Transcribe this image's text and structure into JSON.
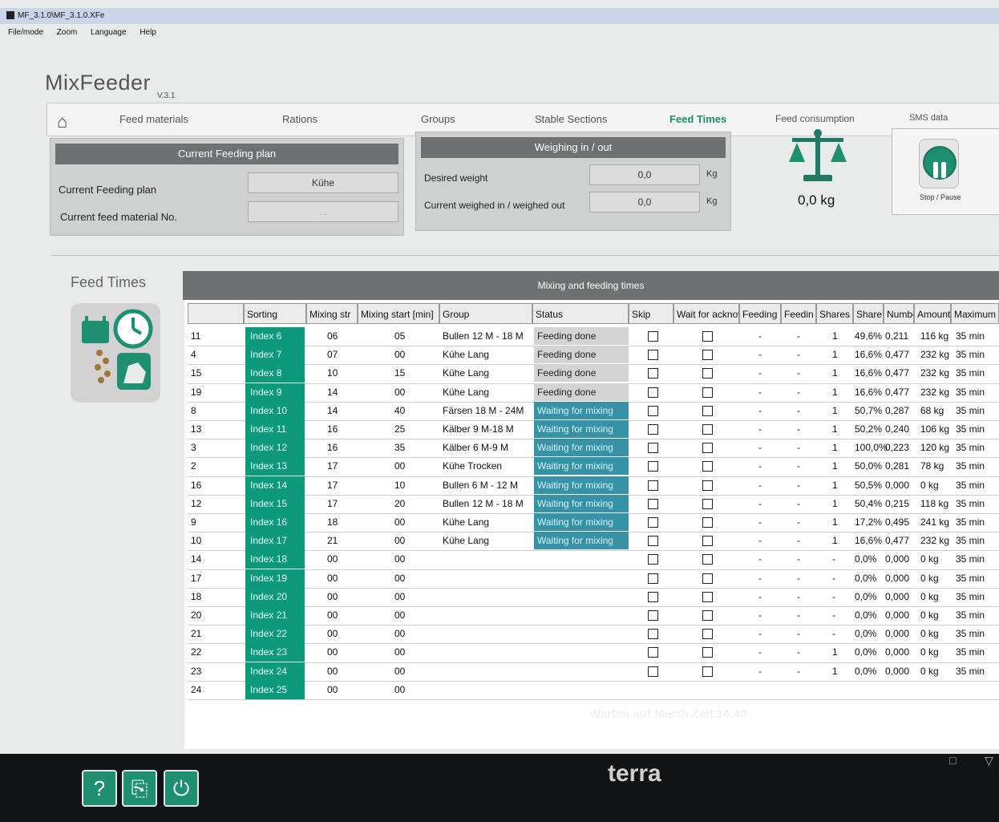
{
  "window": {
    "title": "MF_3.1.0\\MF_3.1.0.XFe"
  },
  "menu": [
    "File/mode",
    "Zoom",
    "Language",
    "Help"
  ],
  "app": {
    "name": "MixFeeder",
    "version": "V.3.1"
  },
  "nav": {
    "tabs": [
      "Feed materials",
      "Rations",
      "Groups",
      "Stable Sections",
      "Feed Times",
      "Feed consumption",
      "SMS data"
    ],
    "active": "Feed Times"
  },
  "current_plan": {
    "header": "Current Feeding plan",
    "plan_label": "Current Feeding plan",
    "plan_value": "Kühe",
    "material_label": "Current feed material No.",
    "material_value": "..."
  },
  "weighing": {
    "header": "Weighing in / out",
    "desired_label": "Desired weight",
    "desired_value": "0,0",
    "desired_unit": "Kg",
    "current_label": "Current weighed in / weighed out",
    "current_value": "0,0",
    "current_unit": "Kg"
  },
  "scale": {
    "value": "0,0 kg"
  },
  "stop": {
    "label": "Stop / Pause"
  },
  "feed_times": {
    "title": "Feed Times"
  },
  "table": {
    "header": "Mixing and feeding times",
    "columns": [
      "",
      "Sorting",
      "Mixing str",
      "Mixing start [min]",
      "Group",
      "Status",
      "Skip",
      "Wait for acknow",
      "Feeding",
      "Feedin",
      "Shares",
      "Share",
      "Numbe",
      "Amount",
      "Maximum"
    ],
    "rows": [
      {
        "id": "11",
        "sort": "Index 6",
        "mix": "06",
        "start": "05",
        "group": "Bullen 12 M - 18 M",
        "status": "Feeding done",
        "feed": "-",
        "feedin": "-",
        "shares": "1",
        "share": "49,6%",
        "num": "0,211",
        "amount": "116 kg",
        "max": "35 min"
      },
      {
        "id": "4",
        "sort": "Index 7",
        "mix": "07",
        "start": "00",
        "group": "Kühe Lang",
        "status": "Feeding done",
        "feed": "-",
        "feedin": "-",
        "shares": "1",
        "share": "16,6%",
        "num": "0,477",
        "amount": "232 kg",
        "max": "35 min"
      },
      {
        "id": "15",
        "sort": "Index 8",
        "mix": "10",
        "start": "15",
        "group": "Kühe Lang",
        "status": "Feeding done",
        "feed": "-",
        "feedin": "-",
        "shares": "1",
        "share": "16,6%",
        "num": "0,477",
        "amount": "232 kg",
        "max": "35 min"
      },
      {
        "id": "19",
        "sort": "Index 9",
        "mix": "14",
        "start": "00",
        "group": "Kühe Lang",
        "status": "Feeding done",
        "feed": "-",
        "feedin": "-",
        "shares": "1",
        "share": "16,6%",
        "num": "0,477",
        "amount": "232 kg",
        "max": "35 min"
      },
      {
        "id": "8",
        "sort": "Index 10",
        "mix": "14",
        "start": "40",
        "group": "Färsen 18 M - 24M",
        "status": "Waiting for mixing",
        "feed": "-",
        "feedin": "-",
        "shares": "1",
        "share": "50,7%",
        "num": "0,287",
        "amount": "68 kg",
        "max": "35 min"
      },
      {
        "id": "13",
        "sort": "Index 11",
        "mix": "16",
        "start": "25",
        "group": "Kälber 9 M-18 M",
        "status": "Waiting for mixing",
        "feed": "-",
        "feedin": "-",
        "shares": "1",
        "share": "50,2%",
        "num": "0,240",
        "amount": "106 kg",
        "max": "35 min"
      },
      {
        "id": "3",
        "sort": "Index 12",
        "mix": "16",
        "start": "35",
        "group": "Kälber 6 M-9 M",
        "status": "Waiting for mixing",
        "feed": "-",
        "feedin": "-",
        "shares": "1",
        "share": "100,0%",
        "num": "0,223",
        "amount": "120 kg",
        "max": "35 min"
      },
      {
        "id": "2",
        "sort": "Index 13",
        "mix": "17",
        "start": "00",
        "group": "Kühe Trocken",
        "status": "Waiting for mixing",
        "feed": "-",
        "feedin": "-",
        "shares": "1",
        "share": "50,0%",
        "num": "0,281",
        "amount": "78 kg",
        "max": "35 min"
      },
      {
        "id": "16",
        "sort": "Index 14",
        "mix": "17",
        "start": "10",
        "group": "Bullen 6 M - 12 M",
        "status": "Waiting for mixing",
        "feed": "-",
        "feedin": "-",
        "shares": "1",
        "share": "50,5%",
        "num": "0,000",
        "amount": "0 kg",
        "max": "35 min"
      },
      {
        "id": "12",
        "sort": "Index 15",
        "mix": "17",
        "start": "20",
        "group": "Bullen 12 M - 18 M",
        "status": "Waiting for mixing",
        "feed": "-",
        "feedin": "-",
        "shares": "1",
        "share": "50,4%",
        "num": "0,215",
        "amount": "118 kg",
        "max": "35 min"
      },
      {
        "id": "9",
        "sort": "Index 16",
        "mix": "18",
        "start": "00",
        "group": "Kühe Lang",
        "status": "Waiting for mixing",
        "feed": "-",
        "feedin": "-",
        "shares": "1",
        "share": "17,2%",
        "num": "0,495",
        "amount": "241 kg",
        "max": "35 min"
      },
      {
        "id": "10",
        "sort": "Index 17",
        "mix": "21",
        "start": "00",
        "group": "Kühe Lang",
        "status": "Waiting for mixing",
        "feed": "-",
        "feedin": "-",
        "shares": "1",
        "share": "16,6%",
        "num": "0,477",
        "amount": "232 kg",
        "max": "35 min"
      },
      {
        "id": "14",
        "sort": "Index 18",
        "mix": "00",
        "start": "00",
        "group": "",
        "status": "",
        "feed": "-",
        "feedin": "-",
        "shares": "-",
        "share": "0,0%",
        "num": "0,000",
        "amount": "0 kg",
        "max": "35 min"
      },
      {
        "id": "17",
        "sort": "Index 19",
        "mix": "00",
        "start": "00",
        "group": "",
        "status": "",
        "feed": "-",
        "feedin": "-",
        "shares": "-",
        "share": "0,0%",
        "num": "0,000",
        "amount": "0 kg",
        "max": "35 min"
      },
      {
        "id": "18",
        "sort": "Index 20",
        "mix": "00",
        "start": "00",
        "group": "",
        "status": "",
        "feed": "-",
        "feedin": "-",
        "shares": "-",
        "share": "0,0%",
        "num": "0,000",
        "amount": "0 kg",
        "max": "35 min"
      },
      {
        "id": "20",
        "sort": "Index 21",
        "mix": "00",
        "start": "00",
        "group": "",
        "status": "",
        "feed": "-",
        "feedin": "-",
        "shares": "-",
        "share": "0,0%",
        "num": "0,000",
        "amount": "0 kg",
        "max": "35 min"
      },
      {
        "id": "21",
        "sort": "Index 22",
        "mix": "00",
        "start": "00",
        "group": "",
        "status": "",
        "feed": "-",
        "feedin": "-",
        "shares": "-",
        "share": "0,0%",
        "num": "0,000",
        "amount": "0 kg",
        "max": "35 min"
      },
      {
        "id": "22",
        "sort": "Index 23",
        "mix": "00",
        "start": "00",
        "group": "",
        "status": "",
        "feed": "-",
        "feedin": "-",
        "shares": "1",
        "share": "0,0%",
        "num": "0,000",
        "amount": "0 kg",
        "max": "35 min"
      },
      {
        "id": "23",
        "sort": "Index 24",
        "mix": "00",
        "start": "00",
        "group": "",
        "status": "",
        "feed": "-",
        "feedin": "-",
        "shares": "1",
        "share": "0,0%",
        "num": "0,000",
        "amount": "0 kg",
        "max": "35 min"
      },
      {
        "id": "24",
        "sort": "Index 25",
        "mix": "00",
        "start": "00",
        "group": "",
        "status": "",
        "feed": "",
        "feedin": "",
        "shares": "",
        "share": "",
        "num": "",
        "amount": "",
        "max": ""
      }
    ]
  },
  "status_bar": {
    "text": "Warten auf Misch Zeit 14.40"
  },
  "monitor": {
    "brand": "terra"
  },
  "colors": {
    "accent": "#0d9a7c",
    "waiting": "#3592a7",
    "header": "#6e7071"
  }
}
